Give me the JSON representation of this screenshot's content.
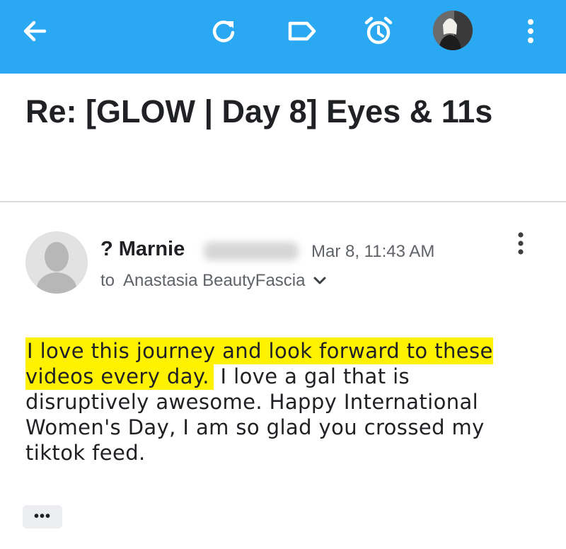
{
  "toolbar": {
    "background_color": "#2aa9f2",
    "icons": [
      "back-arrow-icon",
      "refresh-icon",
      "label-icon",
      "alarm-clock-icon",
      "account-avatar",
      "more-vert-icon"
    ]
  },
  "email": {
    "subject": "Re: [GLOW | Day 8] Eyes & 11s",
    "sender_name": "? Marnie",
    "sender_last_name_blurred": true,
    "date": "Mar 8, 11:43 AM",
    "to_prefix": "to",
    "recipient": "Anastasia BeautyFascia",
    "body_highlighted": "I love this journey and look forward to these videos every day.",
    "body_rest": " I love a gal that is disruptively awesome.  Happy International Women's Day,  I am so glad you crossed my tiktok feed.",
    "highlight_color": "#fff200",
    "trimmed_content_label": "•••"
  }
}
